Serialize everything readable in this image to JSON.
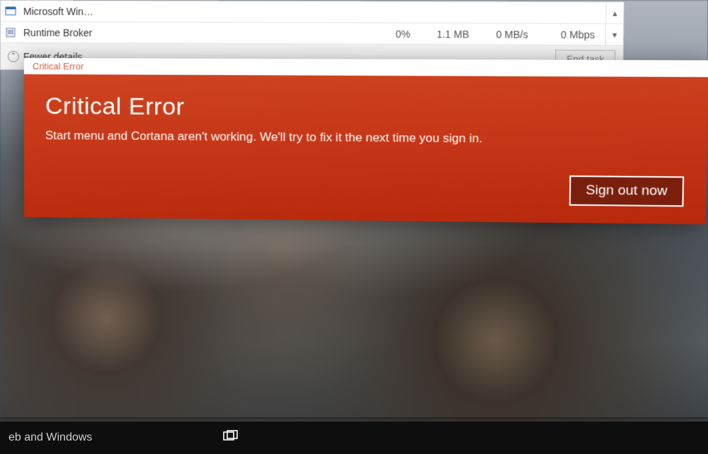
{
  "task_manager": {
    "rows": [
      {
        "icon": "window-icon",
        "name": "Microsoft Win…",
        "cpu": "",
        "mem": "",
        "disk": "",
        "net": ""
      },
      {
        "icon": "process-icon",
        "name": "Runtime Broker",
        "cpu": "0%",
        "mem": "1.1 MB",
        "disk": "0 MB/s",
        "net": "0 Mbps"
      }
    ],
    "fewer_details_label": "Fewer details",
    "end_task_label": "End task"
  },
  "dialog": {
    "titlebar": "Critical Error",
    "heading": "Critical Error",
    "message": "Start menu and Cortana aren't working. We'll try to fix it the next time you sign in.",
    "button_label": "Sign out now"
  },
  "taskbar": {
    "search_placeholder_visible": "eb and Windows"
  },
  "colors": {
    "error_red": "#c63a1a",
    "highlight_white": "#ffffff",
    "taskbar_black": "#0e0e0e"
  }
}
